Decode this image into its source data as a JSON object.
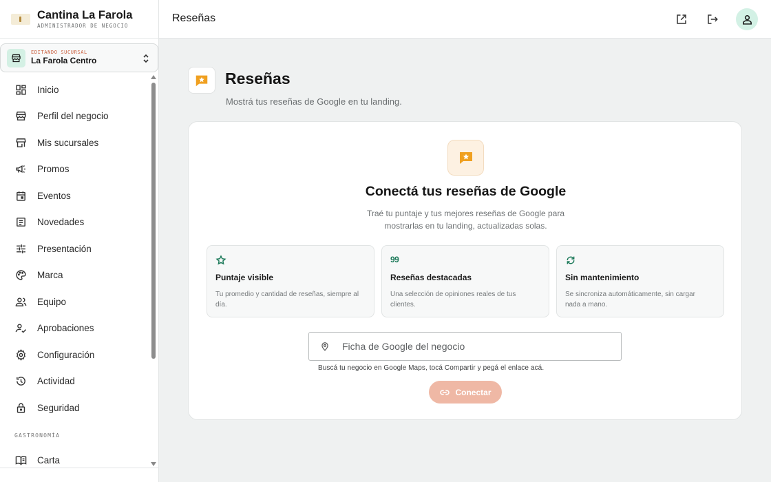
{
  "brand": {
    "name": "Cantina La Farola",
    "subtitle": "ADMINISTRADOR DE NEGOCIO"
  },
  "branch": {
    "eyebrow": "EDITANDO SUCURSAL",
    "name": "La Farola Centro"
  },
  "nav": {
    "items": [
      {
        "label": "Inicio",
        "icon": "dashboard-icon"
      },
      {
        "label": "Perfil del negocio",
        "icon": "storefront-icon"
      },
      {
        "label": "Mis sucursales",
        "icon": "store-icon"
      },
      {
        "label": "Promos",
        "icon": "campaign-icon"
      },
      {
        "label": "Eventos",
        "icon": "calendar-icon"
      },
      {
        "label": "Novedades",
        "icon": "article-icon"
      },
      {
        "label": "Presentación",
        "icon": "tune-icon"
      },
      {
        "label": "Marca",
        "icon": "palette-icon"
      },
      {
        "label": "Equipo",
        "icon": "group-icon"
      },
      {
        "label": "Aprobaciones",
        "icon": "person-check-icon"
      },
      {
        "label": "Configuración",
        "icon": "gear-icon"
      },
      {
        "label": "Actividad",
        "icon": "history-icon"
      },
      {
        "label": "Seguridad",
        "icon": "lock-icon"
      }
    ],
    "section_label": "GASTRONOMÍA",
    "section_items": [
      {
        "label": "Carta",
        "icon": "menu-book-icon"
      }
    ]
  },
  "topbar": {
    "title": "Reseñas"
  },
  "page": {
    "title": "Reseñas",
    "subtitle": "Mostrá tus reseñas de Google en tu landing."
  },
  "card": {
    "title": "Conectá tus reseñas de Google",
    "description_line1": "Traé tu puntaje y tus mejores reseñas de Google para",
    "description_line2": "mostrarlas en tu landing, actualizadas solas.",
    "features": [
      {
        "icon": "star-icon",
        "title": "Puntaje visible",
        "desc_line1": "Tu promedio y cantidad de reseñas, siempre al",
        "desc_line2": "día."
      },
      {
        "icon": "quote-icon",
        "glyph": "99",
        "title": "Reseñas destacadas",
        "desc_line1": "Una selección de opiniones reales de tus",
        "desc_line2": "clientes."
      },
      {
        "icon": "sync-icon",
        "title": "Sin mantenimiento",
        "desc_line1": "Se sincroniza automáticamente, sin cargar",
        "desc_line2": "nada a mano."
      }
    ],
    "input_placeholder": "Ficha de Google del negocio",
    "hint": "Buscá tu negocio en Google Maps, tocá Compartir y pegá el enlace acá.",
    "connect_label": "Conectar"
  },
  "colors": {
    "accent_green": "#1d7a5a",
    "review_orange": "#f0a020",
    "connect_button": "#efb8a5",
    "branch_eyebrow": "#c85d3c",
    "avatar_bg": "#d3f1e5"
  }
}
